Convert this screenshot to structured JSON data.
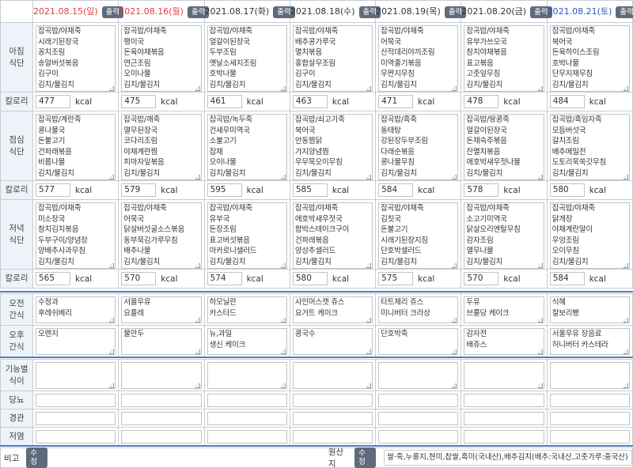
{
  "header": {
    "print_label": "출력",
    "days": [
      {
        "date": "2021.08.15(일)",
        "color": "red"
      },
      {
        "date": "2021.08.16(월)",
        "color": "red"
      },
      {
        "date": "2021.08.17(화)",
        "color": "normal"
      },
      {
        "date": "2021.08.18(수)",
        "color": "normal"
      },
      {
        "date": "2021.08.19(목)",
        "color": "normal"
      },
      {
        "date": "2021.08.20(금)",
        "color": "normal"
      },
      {
        "date": "2021.08.21(토)",
        "color": "blue"
      }
    ]
  },
  "labels": {
    "breakfast": [
      "아침",
      "식단"
    ],
    "lunch": [
      "점심",
      "식단"
    ],
    "dinner": [
      "저녁",
      "식단"
    ],
    "calorie": "칼로리",
    "kcal": "kcal",
    "am_snack": [
      "오전",
      "간식"
    ],
    "pm_snack": [
      "오후",
      "간식"
    ],
    "functional": [
      "기능별",
      "식이"
    ],
    "diabetes": "당뇨",
    "tube": "경관",
    "low_salt": "저염",
    "remark": "비고",
    "edit": "수정",
    "origin": "원산지"
  },
  "breakfast": [
    [
      "잡곡밥/야채죽",
      "시래기된장국",
      "꽁치조림",
      "송알버섯볶음",
      "김구이",
      "김치/물김치"
    ],
    [
      "잡곡밥/야채죽",
      "팽이국",
      "돈육야채볶음",
      "연근조림",
      "오이나물",
      "김치/물김치"
    ],
    [
      "잡곡밥/야채죽",
      "얼갈이된장국",
      "두부조림",
      "옛날소세지조림",
      "호박나물",
      "김치/물김치"
    ],
    [
      "잡곡밥/야채죽",
      "배추콩가루국",
      "멸치볶음",
      "홍합살무조림",
      "김구이",
      "김치/물김치"
    ],
    [
      "잡곡밥/야채죽",
      "어묵국",
      "산적데리야끼조림",
      "미역줄기볶음",
      "무짠지무침",
      "김치/물김치"
    ],
    [
      "잡곡밥/야채죽",
      "유부가쓰오국",
      "참치야채볶음",
      "표고볶음",
      "고춧잎무침",
      "김치/물김치"
    ],
    [
      "잡곡밥/야채죽",
      "북어국",
      "돈육하이스조림",
      "호박나물",
      "단무지채무침",
      "김치/물김치"
    ]
  ],
  "breakfast_kcal": [
    "477",
    "475",
    "461",
    "463",
    "471",
    "478",
    "484"
  ],
  "lunch": [
    [
      "잡곡밥/계란죽",
      "콩나물국",
      "돈불고기",
      "건파래볶음",
      "비름나물",
      "김치/물김치"
    ],
    [
      "잡곡밥/깨죽",
      "열무된장국",
      "코다리조림",
      "야채계란찜",
      "피마자잎볶음",
      "김치/물김치"
    ],
    [
      "잡곡밥/녹두죽",
      "건새우미역국",
      "소불고기",
      "잡채",
      "오이나물",
      "김치/물김치"
    ],
    [
      "잡곡밥/쇠고기죽",
      "북어국",
      "안동찜닭",
      "가지양념찜",
      "우무묵오이무침",
      "김치/물김치"
    ],
    [
      "잡곡밥/흑죽",
      "동태탕",
      "강된장두부조림",
      "다래순볶음",
      "콩나물무침",
      "김치/물김치"
    ],
    [
      "잡곡밥/땅콩죽",
      "얼갈이된장국",
      "돈채숙주볶음",
      "잔멸치볶음",
      "애호박새우젓나물",
      "김치/물김치"
    ],
    [
      "잡곡밥/흑임자죽",
      "모듬버섯국",
      "갈치조림",
      "배추메밀전",
      "도토리묵쑥갓무침",
      "김치/물김치"
    ]
  ],
  "lunch_kcal": [
    "577",
    "579",
    "595",
    "585",
    "584",
    "578",
    "580"
  ],
  "dinner": [
    [
      "잡곡밥/야채죽",
      "미소장국",
      "참치김치볶음",
      "두부구이/양념장",
      "양배추사과무침",
      "김치/물김치"
    ],
    [
      "잡곡밥/야채죽",
      "어묵국",
      "닭살버섯굴소스볶음",
      "동부묵김가루무침",
      "배추나물",
      "김치/물김치"
    ],
    [
      "잡곡밥/야채죽",
      "유부국",
      "돈장조림",
      "표고버섯볶음",
      "마카로니샐러드",
      "김치/물김치"
    ],
    [
      "잡곡밥/야채죽",
      "애호박새우젓국",
      "함박스테이크구이",
      "건파래볶음",
      "양상추샐러드",
      "김치/물김치"
    ],
    [
      "잡곡밥/야채죽",
      "김칫국",
      "돈불고기",
      "시래기된장지짐",
      "단호박샐러드",
      "김치/물김치"
    ],
    [
      "잡곡밥/야채죽",
      "소고기미역국",
      "닭살오리엔탈무침",
      "감자조림",
      "열무나물",
      "김치/물김치"
    ],
    [
      "잡곡밥/야채죽",
      "닭개장",
      "야채계란말이",
      "우엉조림",
      "오이무침",
      "김치/물김치"
    ]
  ],
  "dinner_kcal": [
    "565",
    "570",
    "574",
    "580",
    "575",
    "570",
    "584"
  ],
  "am_snack": [
    [
      "수정과",
      "후레쉬베리"
    ],
    [
      "서울우유",
      "요플레"
    ],
    [
      "하모닐란",
      "카스타드"
    ],
    [
      "사인머스캣 쥬스",
      "요거트 케이크"
    ],
    [
      "타트체리 쥬스",
      "미니버터 크라상"
    ],
    [
      "두유",
      "브룰당 케이크"
    ],
    [
      "식혜",
      "찰보리빵"
    ]
  ],
  "pm_snack": [
    [
      "오렌지"
    ],
    [
      "물만두"
    ],
    [
      "뉴,과일",
      "생신 케이크"
    ],
    [
      "콩국수"
    ],
    [
      "단호박죽"
    ],
    [
      "감자전",
      "배쥬스"
    ],
    [
      "서울우유 장음료",
      "허니버터 카스테라"
    ]
  ],
  "origin_text": "쌀·죽,누룽지,현미,찹쌀,흑미(국내산),배추김치(배추:국내산,고춧가루:중국산)"
}
